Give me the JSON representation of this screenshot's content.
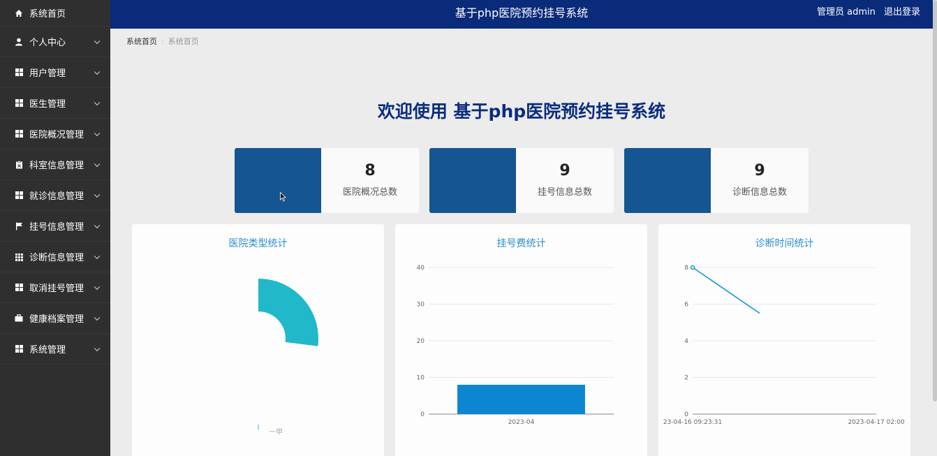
{
  "sidebar": {
    "items": [
      {
        "label": "系统首页",
        "icon": "home-icon",
        "chevron": false
      },
      {
        "label": "个人中心",
        "icon": "user-icon",
        "chevron": true
      },
      {
        "label": "用户管理",
        "icon": "grid-icon",
        "chevron": true
      },
      {
        "label": "医生管理",
        "icon": "grid-icon",
        "chevron": true
      },
      {
        "label": "医院概况管理",
        "icon": "grid-icon",
        "chevron": true
      },
      {
        "label": "科室信息管理",
        "icon": "clipboard-icon",
        "chevron": true
      },
      {
        "label": "就诊信息管理",
        "icon": "grid-icon",
        "chevron": true
      },
      {
        "label": "挂号信息管理",
        "icon": "flag-icon",
        "chevron": true
      },
      {
        "label": "诊断信息管理",
        "icon": "table-icon",
        "chevron": true
      },
      {
        "label": "取消挂号管理",
        "icon": "grid-icon",
        "chevron": true
      },
      {
        "label": "健康档案管理",
        "icon": "briefcase-icon",
        "chevron": true
      },
      {
        "label": "系统管理",
        "icon": "grid-icon",
        "chevron": true
      }
    ]
  },
  "header": {
    "title": "基于php医院预约挂号系统",
    "user": "管理员 admin",
    "logout": "退出登录"
  },
  "breadcrumb": {
    "root": "系统首页",
    "current": "系统首页"
  },
  "welcome": "欢迎使用 基于php医院预约挂号系统",
  "stats": [
    {
      "value": "8",
      "label": "医院概况总数"
    },
    {
      "value": "9",
      "label": "挂号信息总数"
    },
    {
      "value": "9",
      "label": "诊断信息总数"
    }
  ],
  "colors": {
    "accent": "#0a2a7a",
    "card_blue": "#155592",
    "pie": "#21b8c9",
    "bar": "#0c86d1",
    "line": "#0a9ec4"
  },
  "chart_data": [
    {
      "type": "pie",
      "title": "医院类型统计",
      "slices": [
        {
          "label": "一甲",
          "value": 1
        }
      ],
      "legend": [
        "一甲"
      ]
    },
    {
      "type": "bar",
      "title": "挂号费统计",
      "categories": [
        "2023-04"
      ],
      "values": [
        8
      ],
      "ylim": [
        0,
        40
      ],
      "yticks": [
        "0",
        "10",
        "20",
        "30",
        "40"
      ]
    },
    {
      "type": "line",
      "title": "诊断时间统计",
      "x": [
        "23-04-16 09:23:31",
        "2023-04-17 02:00"
      ],
      "values": [
        8,
        5.5
      ],
      "ylim": [
        0,
        8
      ],
      "yticks": [
        "0",
        "2",
        "4",
        "6",
        "8"
      ]
    }
  ]
}
